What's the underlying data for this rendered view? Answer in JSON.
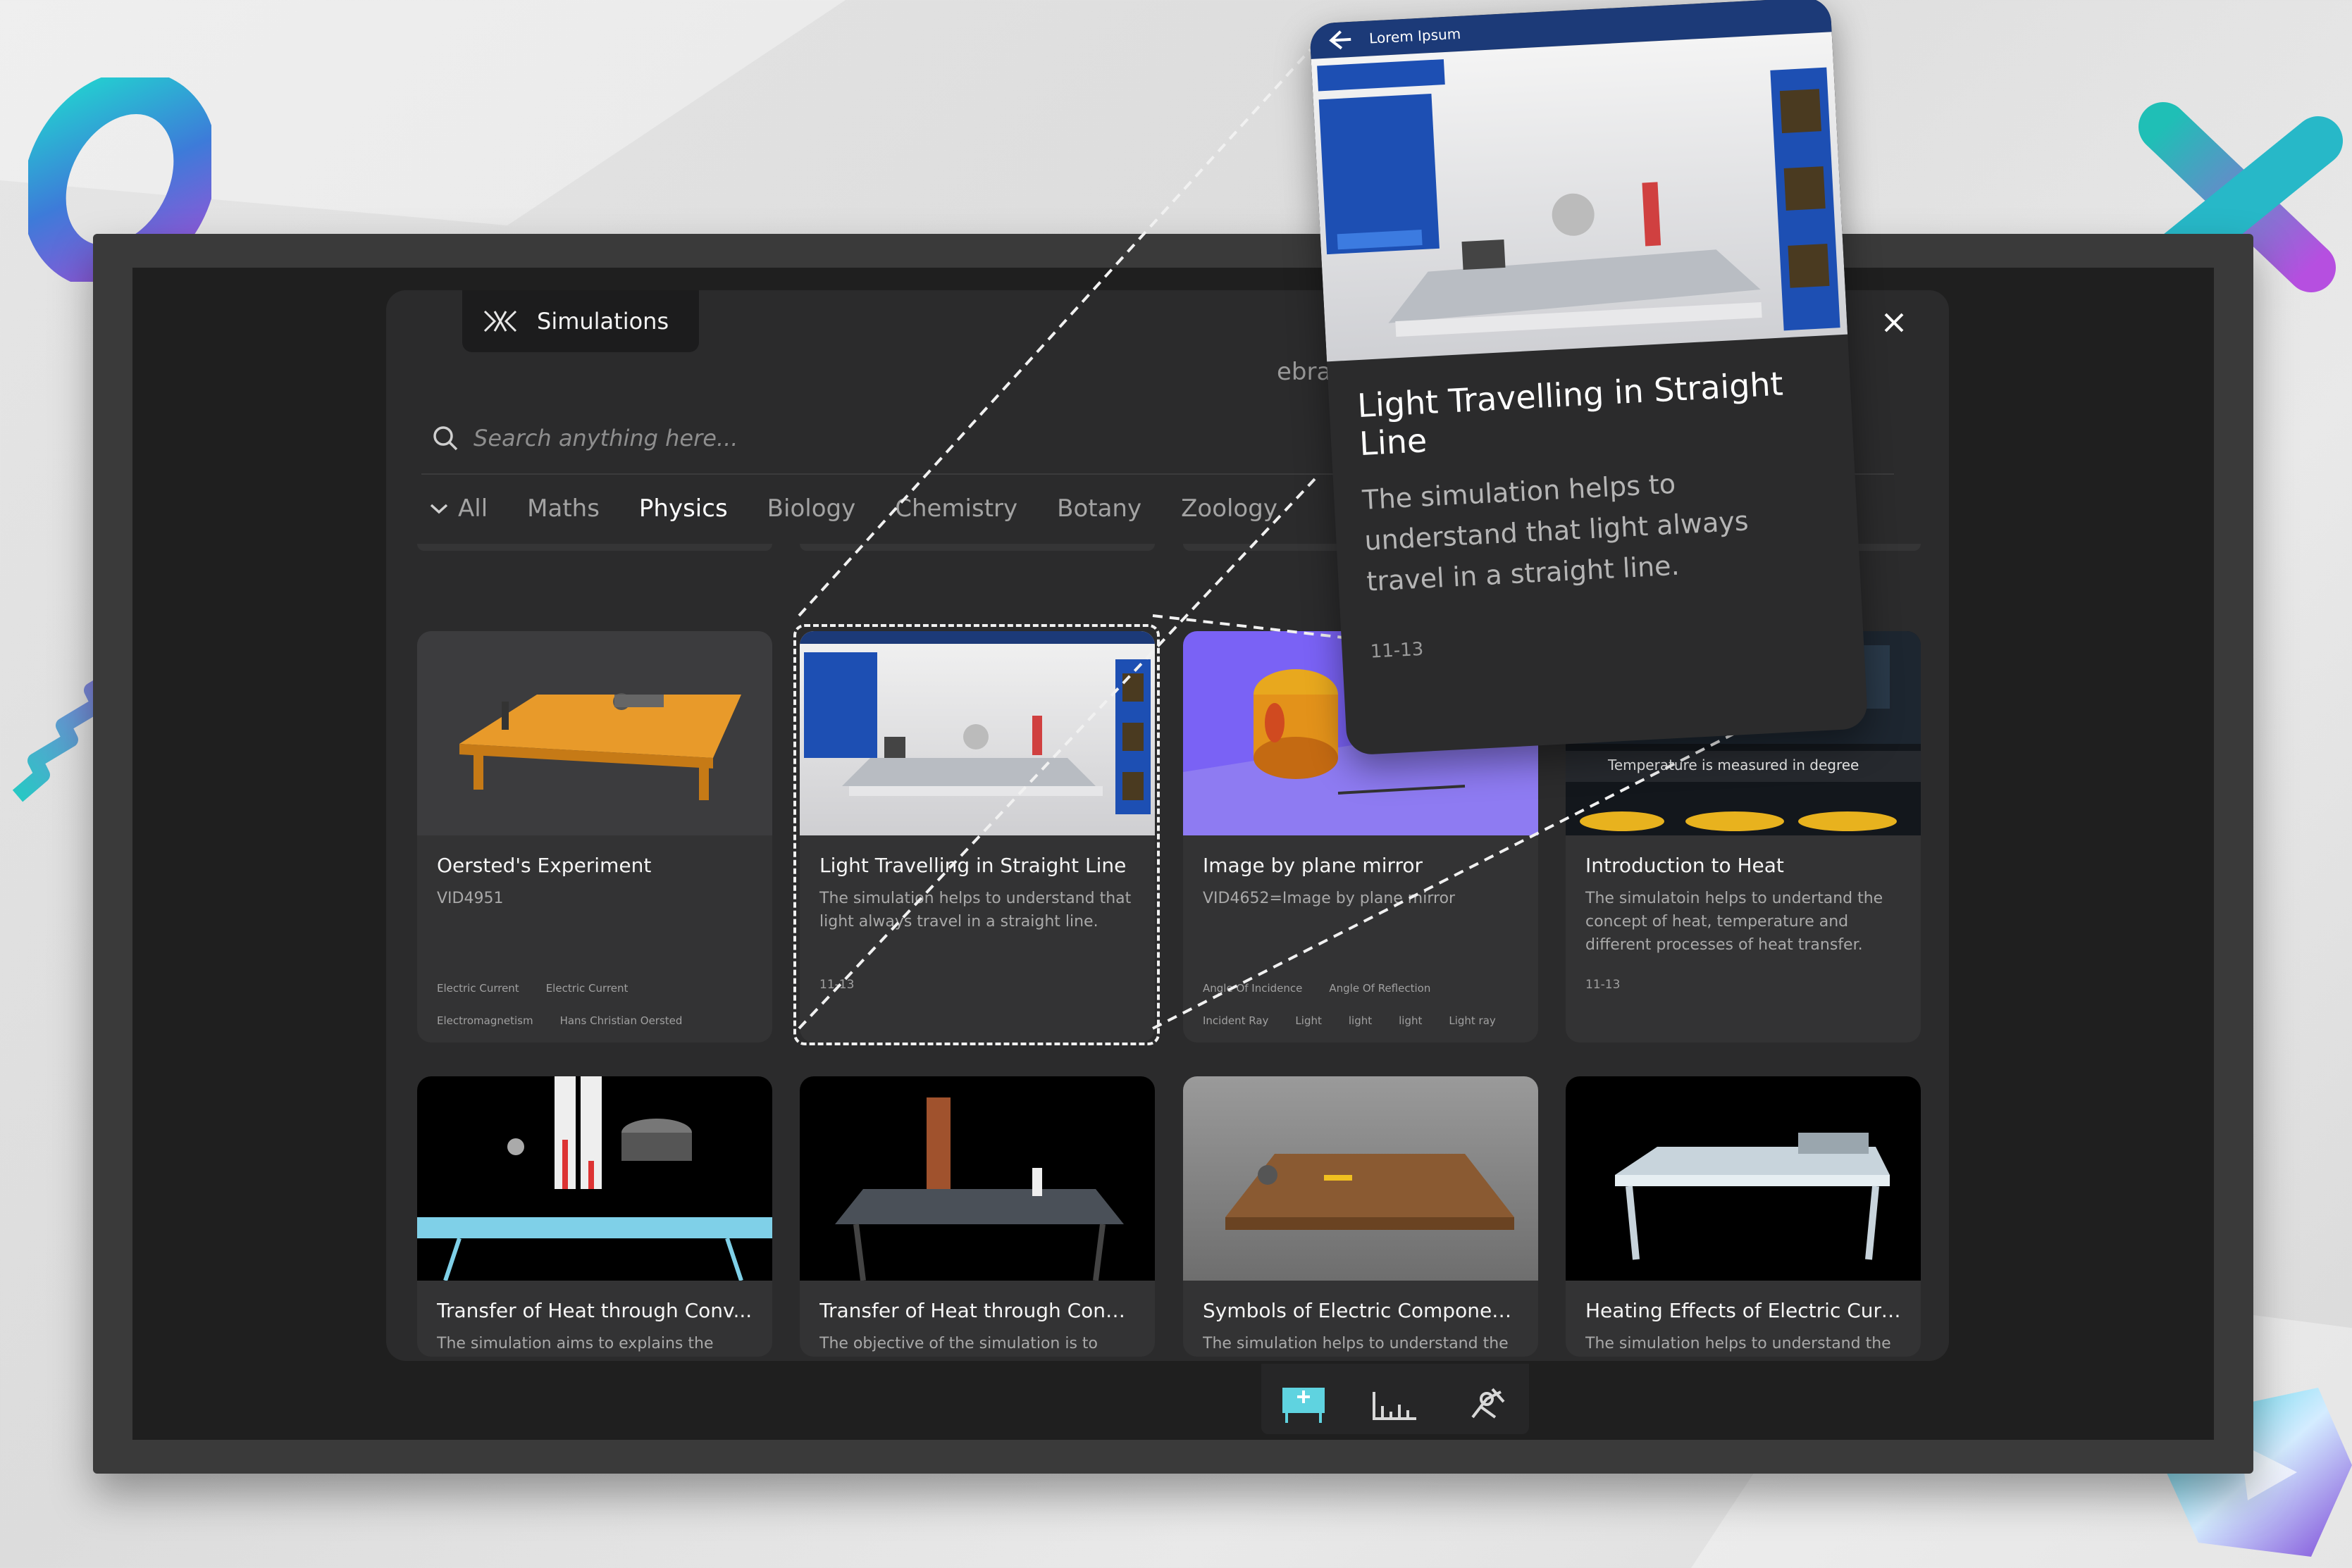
{
  "modal": {
    "tab_label": "Simulations",
    "partial_text": "ebra",
    "close_icon": "close-icon",
    "search_placeholder": "Search anything here...",
    "filters": [
      "All",
      "Maths",
      "Physics",
      "Biology",
      "Chemistry",
      "Botany",
      "Zoology"
    ],
    "active_filter": "Physics"
  },
  "cards": [
    {
      "title": "Oersted's Experiment",
      "subtitle": "VID4951",
      "grade": "",
      "tags": [
        "Electric Current",
        "Electric Current",
        "Electromagnetism",
        "Hans Christian Oersted"
      ]
    },
    {
      "title": "Light Travelling in Straight Line",
      "subtitle": "The simulation helps to understand that light always travel in a straight line.",
      "grade": "11-13",
      "tags": []
    },
    {
      "title": "Image by plane mirror",
      "subtitle": "VID4652=Image by plane mirror",
      "grade": "",
      "tags": [
        "Angle Of Incidence",
        "Angle Of Reflection",
        "Incident Ray",
        "Light",
        "light",
        "light",
        "Light ray"
      ]
    },
    {
      "title": "Introduction to Heat",
      "subtitle": "The simulatoin helps to undertand the concept of heat, temperature and different processes of heat transfer.",
      "grade": "11-13",
      "tags": [],
      "overlay_text": "Temperature is measured in degree"
    },
    {
      "title": "Transfer of Heat through Conv...",
      "subtitle": "The simulation aims to explains the concept of convection where heat",
      "grade": "",
      "tags": []
    },
    {
      "title": "Transfer of Heat through Cond...",
      "subtitle": "The objective of the simulation is to showcase the concept of conduction",
      "grade": "",
      "tags": []
    },
    {
      "title": "Symbols of Electric Componen...",
      "subtitle": "The simulation helps to understand the symbols of",
      "grade": "",
      "tags": []
    },
    {
      "title": "Heating Effects of Electric Curr...",
      "subtitle": "The simulation helps to understand the heating effect of current using a",
      "grade": "",
      "tags": []
    }
  ],
  "popup": {
    "bar_title": "Lorem Ipsum",
    "title": "Light Travelling in Straight Line",
    "description": "The simulation helps to understand that light always travel in a straight line.",
    "grade": "11-13"
  },
  "dock": {
    "items": [
      "whiteboard-icon",
      "chart-tools-icon",
      "simulation-icon"
    ]
  },
  "colors": {
    "accent_purple": "#7b61ff",
    "screen_bg": "#1f1f1f",
    "modal_bg": "#2b2b2c"
  }
}
